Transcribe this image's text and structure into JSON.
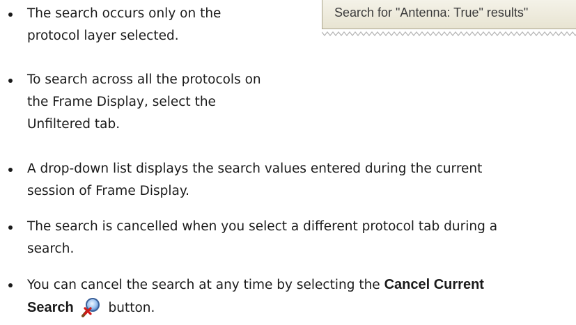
{
  "bullets": [
    {
      "text": "The search occurs only on the\nprotocol layer selected."
    },
    {
      "text": "To search across all the protocols on\nthe Frame Display, select the\nUnfiltered tab."
    },
    {
      "text": "A drop-down list displays the search values entered during the current\nsession of Frame Display."
    },
    {
      "text": "The search is cancelled when you select a different protocol tab during a\nsearch."
    },
    {
      "prefix": "You can cancel the search at any time by selecting the ",
      "bold": "Cancel Current",
      "bold2": "Search",
      "suffix": " button."
    }
  ],
  "screenshot": {
    "tooltip_text": "Search for \"Antenna: True\" results\""
  },
  "icons": {
    "cancel_search": "cancel-search-icon"
  }
}
